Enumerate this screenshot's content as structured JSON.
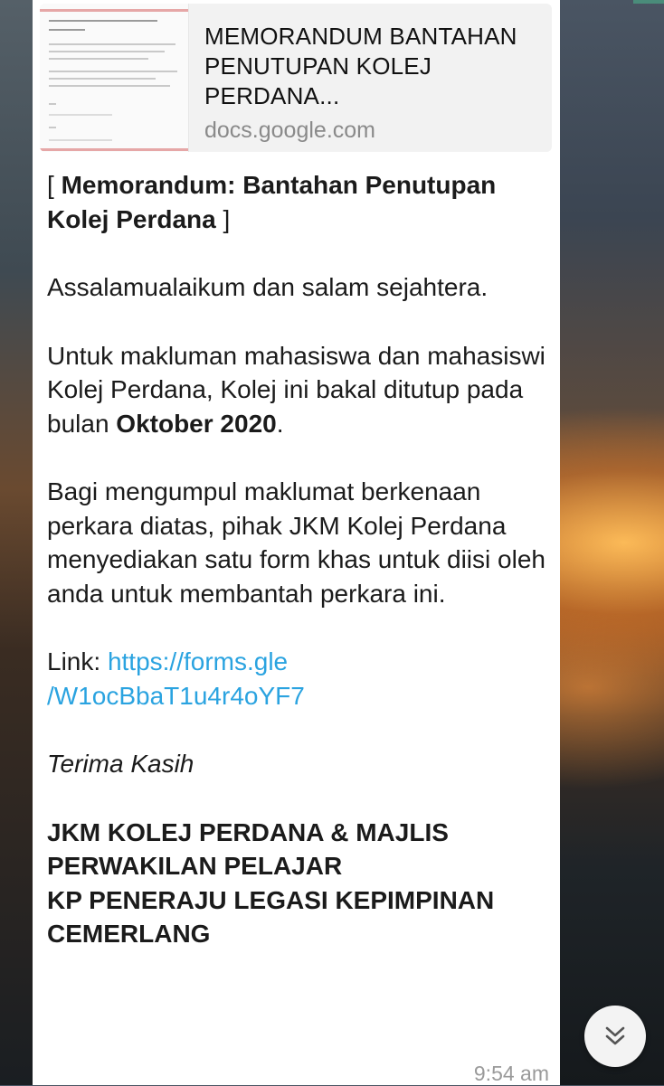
{
  "link_preview": {
    "title": "MEMORANDUM BANTAHAN PENUTUPAN KOLEJ PERDANA...",
    "domain": "docs.google.com"
  },
  "message": {
    "heading_open": "[ ",
    "heading_bold": "Memorandum: Bantahan Penutupan Kolej Perdana",
    "heading_close": " ]",
    "greeting": "Assalamualaikum dan salam sejahtera.",
    "para1_text": "Untuk makluman mahasiswa dan mahasiswi Kolej Perdana, Kolej ini bakal ditutup pada bulan ",
    "para1_bold": "Oktober 2020",
    "para1_end": ".",
    "para2": "Bagi mengumpul maklumat berkenaan perkara diatas, pihak JKM Kolej Perdana menyediakan satu form khas untuk diisi oleh anda untuk membantah perkara ini.",
    "link_label": "Link: ",
    "link_line1": "https://forms.gle",
    "link_line2": "/W1ocBbaT1u4r4oYF7",
    "thanks": "Terima Kasih",
    "signature_line1": "JKM KOLEJ PERDANA & MAJLIS PERWAKILAN PELAJAR",
    "signature_line2": "KP PENERAJU LEGASI KEPIMPINAN CEMERLANG",
    "time": "9:54 am"
  },
  "controls": {
    "scroll_down_icon": "double-chevron-down-icon"
  },
  "colors": {
    "link": "#2aa3e0",
    "bubble": "#ffffff",
    "preview_bg": "#f2f2f2"
  }
}
